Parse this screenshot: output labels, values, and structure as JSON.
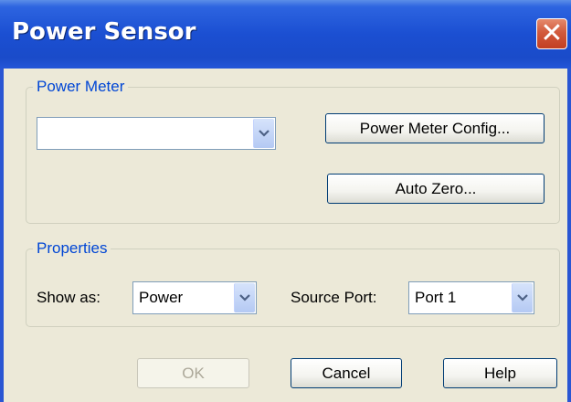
{
  "window": {
    "title": "Power Sensor"
  },
  "power_meter": {
    "group_title": "Power Meter",
    "selected_meter": "",
    "config_button": "Power Meter Config...",
    "auto_zero_button": "Auto Zero..."
  },
  "properties": {
    "group_title": "Properties",
    "show_as_label": "Show as:",
    "show_as_value": "Power",
    "source_port_label": "Source Port:",
    "source_port_value": "Port 1"
  },
  "buttons": {
    "ok": "OK",
    "cancel": "Cancel",
    "help": "Help"
  },
  "colors": {
    "title_bar": "#1b4fd2",
    "dialog_bg": "#ece9d8",
    "group_title": "#0046d5",
    "close_button": "#c23f22"
  }
}
